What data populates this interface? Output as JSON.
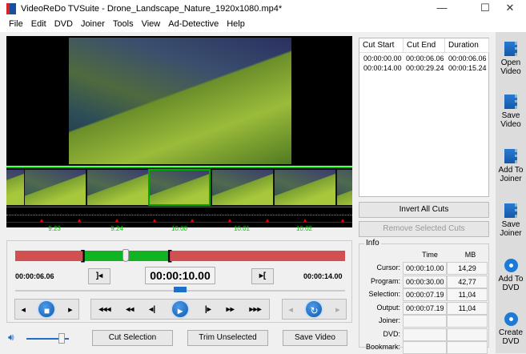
{
  "window": {
    "title": "VideoReDo TVSuite - Drone_Landscape_Nature_1920x1080.mp4*",
    "minimize": "—",
    "maximize": "☐",
    "close": "✕"
  },
  "menu": [
    "File",
    "Edit",
    "DVD",
    "Joiner",
    "Tools",
    "View",
    "Ad-Detective",
    "Help"
  ],
  "timeline": {
    "labels": [
      "9.23",
      "9.24",
      "10.00",
      "10.01",
      "10.02"
    ]
  },
  "controls": {
    "sel_start": "00:00:06.06",
    "sel_end": "00:00:14.00",
    "current_time": "00:00:10.00",
    "set_start_icon": "]◂",
    "set_end_icon": "▸[",
    "cursor_fraction": 0.333,
    "selection_start_fraction": 0.2,
    "selection_end_fraction": 0.467,
    "volume_fraction": 0.85,
    "left_group": [
      "◂",
      "▸"
    ],
    "transport": [
      "◂◂◂",
      "◂◂",
      "◂|",
      "▸",
      "|▸",
      "▸▸",
      "▸▸▸"
    ],
    "right_group": [
      "◂",
      "▸"
    ],
    "cut_selection": "Cut Selection",
    "trim_unselected": "Trim Unselected",
    "save_video": "Save Video"
  },
  "cuts": {
    "headers": [
      "Cut Start",
      "Cut End",
      "Duration"
    ],
    "rows": [
      [
        "00:00:00.00",
        "00:00:06.06",
        "00:00:06.06"
      ],
      [
        "00:00:14.00",
        "00:00:29.24",
        "00:00:15.24"
      ]
    ],
    "invert": "Invert All Cuts",
    "remove": "Remove Selected Cuts"
  },
  "info": {
    "title": "Info",
    "col_time": "Time",
    "col_mb": "MB",
    "rows": [
      {
        "label": "Cursor:",
        "time": "00:00:10.00",
        "mb": "14,29"
      },
      {
        "label": "Program:",
        "time": "00:00:30.00",
        "mb": "42,77"
      },
      {
        "label": "Selection:",
        "time": "00:00:07.19",
        "mb": "11,04"
      },
      {
        "label": "Output:",
        "time": "00:00:07.19",
        "mb": "11,04"
      },
      {
        "label": "Joiner:",
        "time": "",
        "mb": ""
      },
      {
        "label": "DVD:",
        "time": "",
        "mb": ""
      },
      {
        "label": "Bookmark:",
        "time": "",
        "mb": ""
      }
    ]
  },
  "sidebar": [
    {
      "l1": "Open",
      "l2": "Video"
    },
    {
      "l1": "Save",
      "l2": "Video"
    },
    {
      "l1": "Add To",
      "l2": "Joiner"
    },
    {
      "l1": "Save",
      "l2": "Joiner"
    },
    {
      "l1": "Add To",
      "l2": "DVD"
    },
    {
      "l1": "Create",
      "l2": "DVD"
    }
  ],
  "colors": {
    "cut_region": "#d25050",
    "kept_region": "#12b322",
    "accent": "#1d6fc8"
  }
}
